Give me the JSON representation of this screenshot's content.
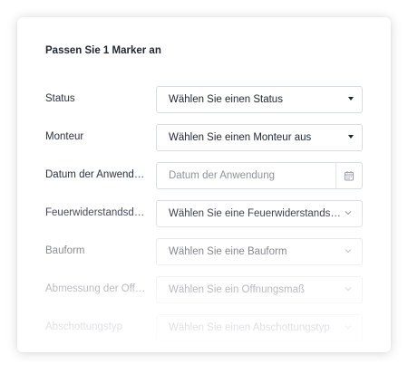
{
  "panel": {
    "title": "Passen Sie 1 Marker an"
  },
  "fields": [
    {
      "label": "Status",
      "value": "Wählen Sie einen Status",
      "kind": "select",
      "icon": "caret-down-icon"
    },
    {
      "label": "Monteur",
      "value": "Wählen Sie einen Monteur aus",
      "kind": "select",
      "icon": "caret-down-icon"
    },
    {
      "label": "Datum der Anwendung",
      "placeholder": "Datum der Anwendung",
      "kind": "date",
      "icon": "calendar-icon"
    },
    {
      "label": "Feuerwiderstandsdauer",
      "value": "Wählen Sie eine Feuerwiderstandsdauer",
      "kind": "select",
      "icon": "chevron-down-icon"
    },
    {
      "label": "Bauform",
      "value": "Wählen Sie eine Bauform",
      "kind": "select",
      "icon": "chevron-down-icon"
    },
    {
      "label": "Abmessung der Öffnung",
      "value": "Wählen Sie ein Öffnungsmaß",
      "kind": "select",
      "icon": "chevron-down-icon"
    },
    {
      "label": "Abschottungstyp",
      "value": "Wählen Sie einen Abschottungstyp",
      "kind": "select",
      "icon": "chevron-down-icon"
    }
  ],
  "colors": {
    "label_text": "#2b3140",
    "field_border": "#d8dce3",
    "placeholder_text": "#8d939c"
  }
}
